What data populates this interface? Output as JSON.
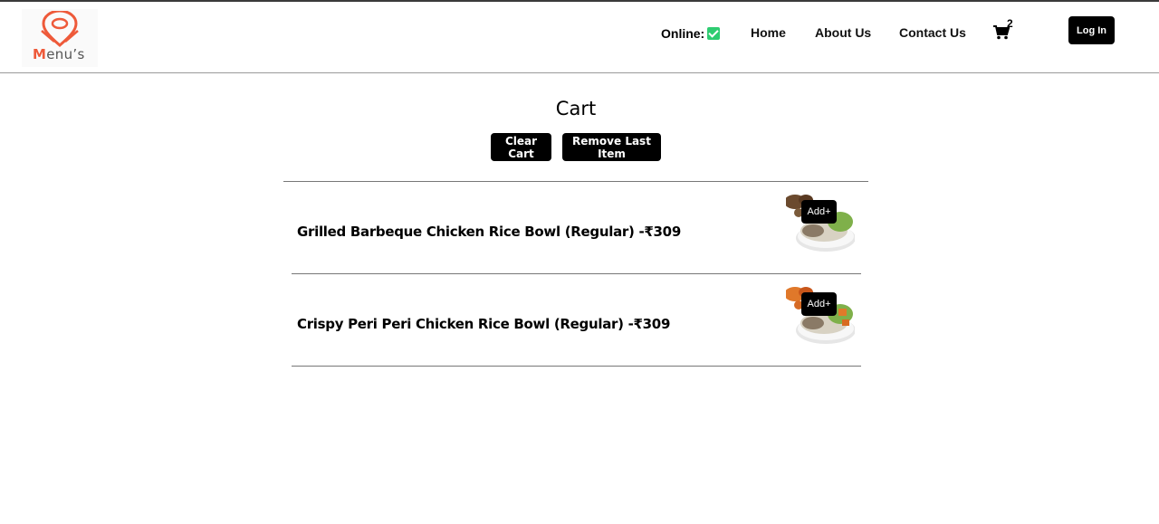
{
  "header": {
    "logo_text_first": "M",
    "logo_text_rest": "enu’s",
    "online_label": "Online:",
    "nav": {
      "home": "Home",
      "about": "About Us",
      "contact": "Contact Us"
    },
    "cart_count": "2",
    "login_label": "Log In"
  },
  "main": {
    "title": "Cart",
    "clear_cart_label": "Clear Cart",
    "remove_last_label": "Remove Last Item",
    "items": [
      {
        "name": "Grilled Barbeque Chicken Rice Bowl (Regular) -₹309",
        "add_label": "Add+",
        "image": "bbq-chicken-rice-bowl"
      },
      {
        "name": "Crispy Peri Peri Chicken Rice Bowl (Regular) -₹309",
        "add_label": "Add+",
        "image": "peri-peri-chicken-rice-bowl"
      }
    ]
  },
  "colors": {
    "brand": "#ee5a3a",
    "online_check": "#2ecc71",
    "button_bg": "#000000"
  },
  "icons": [
    "logo-pin-icon",
    "check-icon",
    "cart-icon"
  ]
}
